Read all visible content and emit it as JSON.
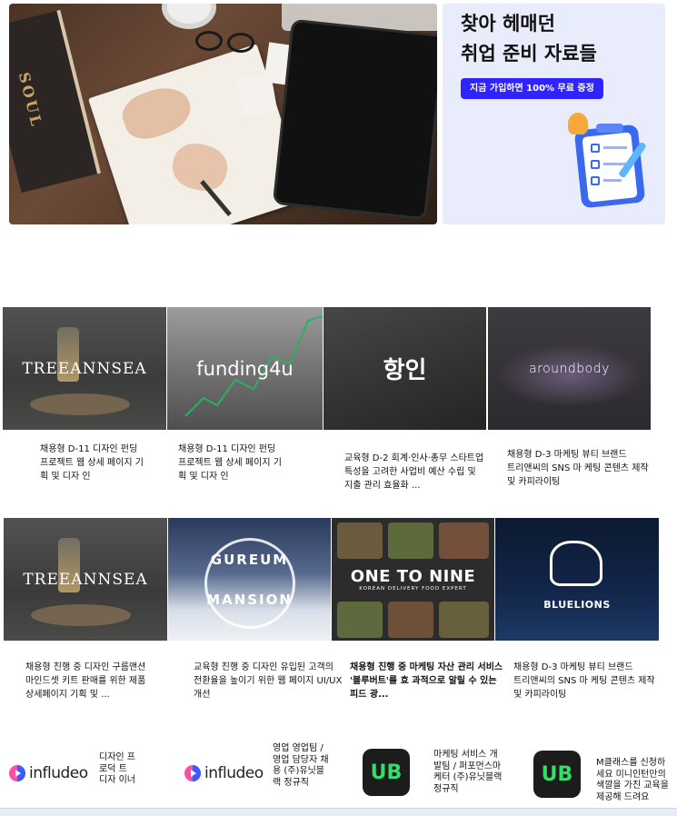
{
  "promo": {
    "title_line1": "찾아 헤매던",
    "title_line2": "취업 준비 자료들",
    "badge": "지금 가입하면 100% 무료 증정"
  },
  "photo": {
    "book_text": "SOUL"
  },
  "cards_row1": [
    {
      "brand": "TREEANNSEA",
      "text": "채용형 D-11 디자인 펀딩 프로젝트 웹 상세 페이지 기 획 및 디자 인"
    },
    {
      "brand": "funding4u",
      "text": "채용형 D-11 디자인 펀딩 프로젝트 웹 상세 페이지 기 획 및 디자 인"
    },
    {
      "brand": "항인",
      "text": "교육형 D-2 회계·인사·총무 스타트업 특성을 고려한 사업비 예산 수립 및 지출 관리 효율화 ..."
    },
    {
      "brand": "aroundbody",
      "text": "채용형 D-3 마케팅 뷰티 브랜드 트리앤씨의 SNS 마 케팅 콘텐츠 제작 및 카피라이팅"
    }
  ],
  "cards_row2": [
    {
      "brand": "TREEANNSEA",
      "text": "채용형 진행 중 디자인 구름맨션 마인드셋 키트 판매를 위한 제품 상세페이지 기획 및 ..."
    },
    {
      "brand_line1": "GUREUM",
      "brand_line2": "MANSION",
      "text": "교육형 진행 중 디자인 유입된 고객의 전환율을 높이기 위한 웹 페이지 UI/UX 개선"
    },
    {
      "brand": "ONE TO NINE",
      "sub": "KOREAN DELIVERY FOOD EXPERT",
      "text": "채용형 진행 중 마케팅 자산 관리 서비스 '블루버트'를 효 과적으로 알릴 수 있는 피드 광..."
    },
    {
      "brand": "BLUELIONS",
      "text": "채용형 D-3 마케팅 뷰티 브랜드 트리앤씨의 SNS 마 케팅 콘텐츠 제작 및 카피라이팅"
    }
  ],
  "bottom": [
    {
      "logo": "infludeo",
      "text": "디자인 프로덕 트 디자 이너"
    },
    {
      "logo": "infludeo",
      "text": "영업 영업팀 / 영업 담당자 채용 (주)유닛블랙 정규직"
    },
    {
      "logo": "UB",
      "text": "마케팅 서비스 개발팀 / 퍼포먼스마케터 (주)유닛블랙 정규직"
    },
    {
      "logo": "UB",
      "text": "M클래스를 신청하세요 미니인턴만의 색깔을 가진 교육을 제공해 드려요"
    }
  ],
  "colors": {
    "promo_bg": "#e9edfb",
    "badge_bg": "#2f23ff",
    "ub_green": "#2ee068"
  }
}
